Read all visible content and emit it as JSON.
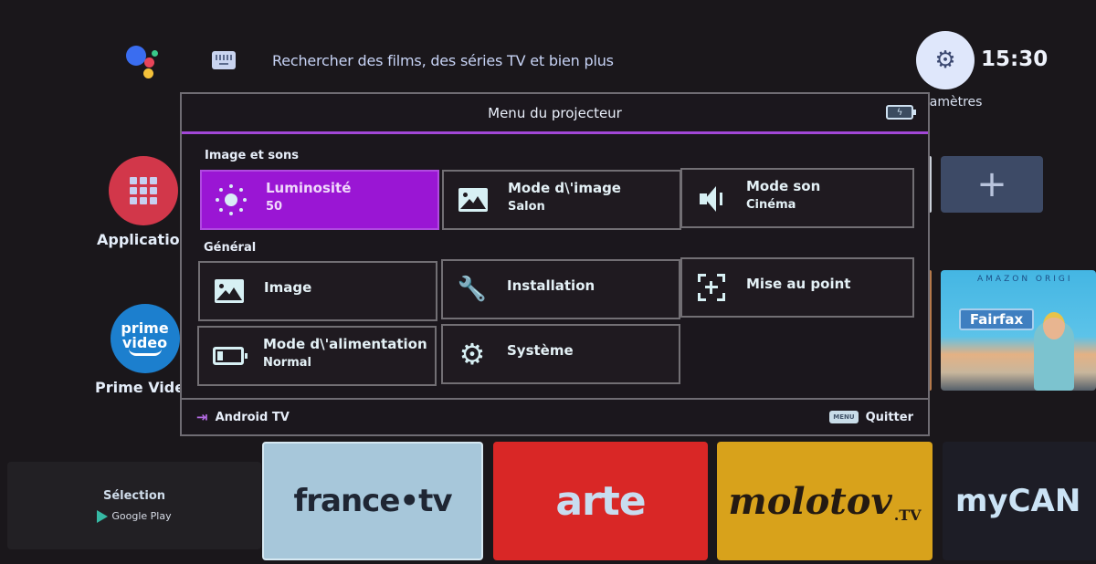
{
  "top_bar": {
    "search_placeholder": "Rechercher des films, des séries TV et bien plus",
    "settings_label": "Paramètres",
    "settings_label_visible": "ramètres",
    "clock": "15:30"
  },
  "launcher": {
    "side_apps": [
      {
        "label": "Application",
        "icon": "apps-grid-icon"
      },
      {
        "label": "Prime Video",
        "icon": "prime-video-logo",
        "logo_line1": "prime",
        "logo_line2": "video"
      }
    ],
    "add_button_symbol": "+",
    "featured": {
      "badge": "AMAZON ORIGI",
      "title": "Fairfax"
    },
    "selection": {
      "title": "Sélection",
      "store": "Google Play"
    },
    "channels": [
      {
        "label": "france•tv",
        "color": "#a7c7da"
      },
      {
        "label": "arte",
        "color": "#d92726"
      },
      {
        "label": "molotov",
        "suffix": ".TV",
        "color": "#d8a21b"
      },
      {
        "label": "myCAN",
        "color": "#1d1d26"
      }
    ]
  },
  "projector_menu": {
    "title": "Menu du projecteur",
    "accent_color": "#9a16d4",
    "sections": [
      {
        "label": "Image et sons",
        "items": [
          {
            "name": "Luminosité",
            "value": "50",
            "icon": "brightness-icon",
            "selected": true
          },
          {
            "name": "Mode d\\'image",
            "value": "Salon",
            "icon": "picture-mode-icon"
          },
          {
            "name": "Mode son",
            "value": "Cinéma",
            "icon": "speaker-icon"
          }
        ]
      },
      {
        "label": "Général",
        "items": [
          {
            "name": "Image",
            "icon": "image-icon"
          },
          {
            "name": "Installation",
            "icon": "wrench-icon"
          },
          {
            "name": "Mise au point",
            "icon": "focus-icon"
          },
          {
            "name": "Mode d\\'alimentation",
            "value": "Normal",
            "icon": "battery-icon"
          },
          {
            "name": "Système",
            "icon": "gear-icon"
          }
        ]
      }
    ],
    "footer": {
      "source_label": "Android TV",
      "menu_key": "MENU",
      "quit_label": "Quitter"
    }
  }
}
